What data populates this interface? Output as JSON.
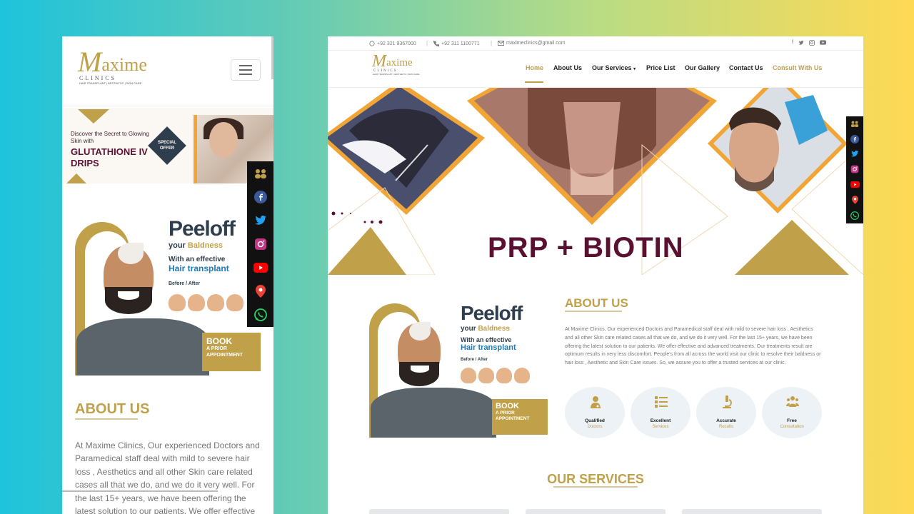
{
  "brand": {
    "name_initial": "M",
    "name_rest": "axime",
    "sub": "CLINICS",
    "tagline": "HAIR TRANSPLANT | AESTHETIC | SKIN CARE"
  },
  "topbar": {
    "whatsapp": "+92 321 9367000",
    "phone": "+92 311 1100771",
    "email": "maximeclinics@gmail.com"
  },
  "nav": {
    "items": [
      "Home",
      "About Us",
      "Our Services",
      "Price List",
      "Our Gallery",
      "Contact Us",
      "Consult With Us"
    ],
    "active": "Home",
    "dropdown_item": "Our Services"
  },
  "hero": {
    "title": "PRP + BIOTIN"
  },
  "promo": {
    "line1": "Discover the Secret to Glowing Skin with",
    "line2": "GLUTATHIONE IV DRIPS",
    "badge": "SPECIAL OFFER"
  },
  "peel": {
    "title": "Peeloff",
    "sub_prefix": "your",
    "sub_highlight": "Baldness",
    "line_prefix": "With an effective",
    "line_highlight": "Hair transplant",
    "before_after": "Before / After",
    "book_line1": "BOOK",
    "book_line2": "A PRIOR",
    "book_line3": "APPOINTMENT"
  },
  "about": {
    "title": "ABOUT US",
    "text": "At Maxime Clinics, Our experienced Doctors and Paramedical staff deal with mild to severe hair loss , Aesthetics and all other Skin care related cases all that we do, and we do it very well. For the last 15+ years, we have been offering the latest solution to our patients. We offer effective and advanced treatments. Our treatments result are optimum results in very less discomfort. People's from all across the world visit our clinic to resolve their baldness or hair loss , Aesthetic and Skin Care issues. So, we assure you to offer a trusted services at our clinic.",
    "mobile_text": "At Maxime Clinics, Our experienced Doctors and Paramedical staff deal with mild to severe hair loss , Aesthetics and all other Skin care related cases all that we do, and we do it very well. For the last 15+ years, we have been offering the latest solution to our patients. We offer effective",
    "features": [
      {
        "line1": "Qualified",
        "line2": "Doctors",
        "icon": "doctor-icon"
      },
      {
        "line1": "Excellent",
        "line2": "Services",
        "icon": "list-icon"
      },
      {
        "line1": "Accurate",
        "line2": "Results",
        "icon": "microscope-icon"
      },
      {
        "line1": "Free",
        "line2": "Consultation",
        "icon": "users-icon"
      }
    ]
  },
  "services": {
    "title": "OUR SERVICES"
  },
  "social": [
    "users-icon",
    "facebook-icon",
    "twitter-icon",
    "instagram-icon",
    "youtube-icon",
    "location-icon",
    "whatsapp-icon"
  ],
  "colors": {
    "gold": "#c1a04a",
    "maroon": "#5a1030",
    "navy": "#2f3e4d",
    "orange": "#f2a537"
  }
}
